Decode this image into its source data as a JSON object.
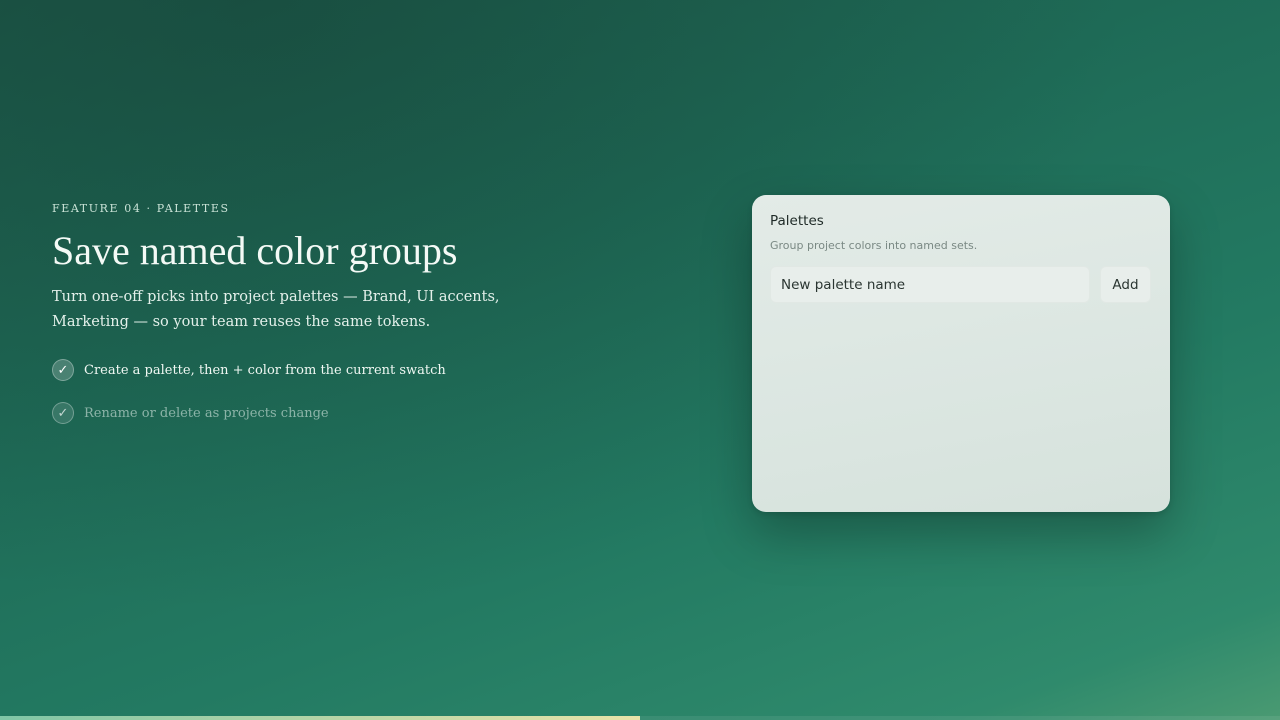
{
  "feature": {
    "eyebrow": "FEATURE 04 · PALETTES",
    "headline": "Save named color groups",
    "lede": "Turn one-off picks into project palettes — Brand, UI accents, Marketing — so your team reuses the same tokens.",
    "bullets": [
      {
        "text": "Create a palette, then + color from the current swatch",
        "check": "✓"
      },
      {
        "text": "Rename or delete as projects change",
        "check": "✓"
      }
    ]
  },
  "card": {
    "title": "Palettes",
    "subtitle": "Group project colors into named sets.",
    "input_placeholder": "New palette name",
    "add_label": "Add"
  },
  "progress": {
    "fraction": 0.5
  }
}
